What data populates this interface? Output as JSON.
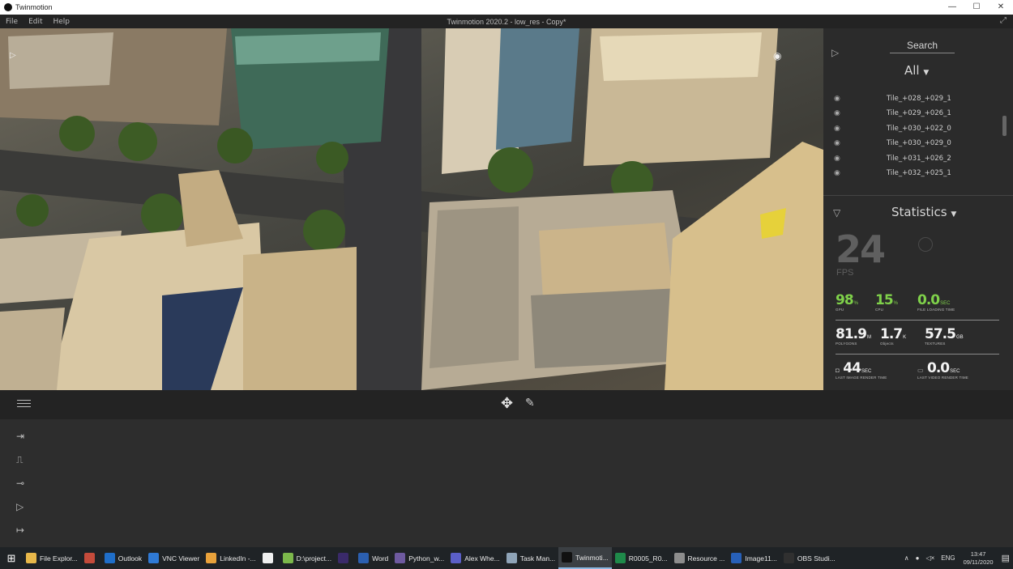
{
  "window": {
    "app_name": "Twinmotion",
    "doc_title": "Twinmotion 2020.2 - low_res - Copy*",
    "controls": {
      "minimize": "—",
      "maximize": "☐",
      "close": "✕"
    }
  },
  "menu": [
    "File",
    "Edit",
    "Help"
  ],
  "scene_panel": {
    "search_label": "Search",
    "filter_label": "All",
    "items": [
      "Tile_+028_+029_1",
      "Tile_+029_+026_1",
      "Tile_+030_+022_0",
      "Tile_+030_+029_0",
      "Tile_+031_+026_2",
      "Tile_+032_+025_1"
    ]
  },
  "statistics": {
    "title": "Statistics",
    "fps_value": "24",
    "fps_label": "FPS",
    "gpu": {
      "value": "98",
      "unit": "%",
      "label": "GPU"
    },
    "cpu": {
      "value": "15",
      "unit": "%",
      "label": "CPU"
    },
    "file_loading": {
      "value": "0.0",
      "unit": "SEC",
      "label": "FILE LOADING TIME"
    },
    "polygons": {
      "value": "81.9",
      "unit": "M",
      "label": "POLYGONS"
    },
    "objects": {
      "value": "1.7",
      "unit": "K",
      "label": "Objects"
    },
    "textures": {
      "value": "57.5",
      "unit": "GB",
      "label": "TEXTURES"
    },
    "image_render": {
      "value": "44",
      "unit": "SEC",
      "label": "LAST IMAGE RENDER TIME"
    },
    "video_render": {
      "value": "0.0",
      "unit": "SEC",
      "label": "LAST VIDEO RENDER TIME"
    }
  },
  "taskbar": {
    "items": [
      {
        "label": "File Explor...",
        "color": "#e8b84a"
      },
      {
        "label": "",
        "color": "#c44b3b"
      },
      {
        "label": "Outlook",
        "color": "#1f6ec9"
      },
      {
        "label": "VNC Viewer",
        "color": "#2f7ad6"
      },
      {
        "label": "LinkedIn -...",
        "color": "#e9a23b"
      },
      {
        "label": "",
        "color": "#f0f0f0"
      },
      {
        "label": "D:\\project...",
        "color": "#7cb84b"
      },
      {
        "label": "",
        "color": "#3a2a6a"
      },
      {
        "label": "Word",
        "color": "#2b5fb0"
      },
      {
        "label": "Python_w...",
        "color": "#6e5aa0"
      },
      {
        "label": "Alex Whe...",
        "color": "#5b5fc7"
      },
      {
        "label": "Task Man...",
        "color": "#8fa4b8"
      },
      {
        "label": "Twinmoti...",
        "color": "#111111"
      },
      {
        "label": "R0005_R0...",
        "color": "#1f8a4a"
      },
      {
        "label": "Resource ...",
        "color": "#8d8d8d"
      },
      {
        "label": "Image11...",
        "color": "#2760b8"
      },
      {
        "label": "OBS Studi...",
        "color": "#303030"
      }
    ],
    "active_index": 12,
    "tray_lang": "ENG",
    "time": "13:47",
    "date": "09/11/2020"
  }
}
